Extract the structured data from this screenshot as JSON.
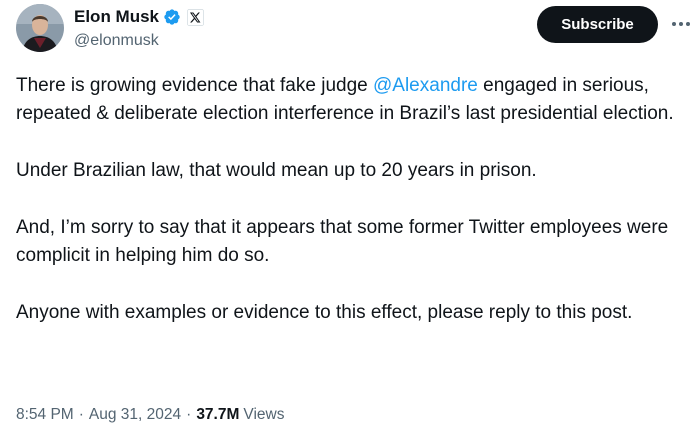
{
  "author": {
    "name": "Elon Musk",
    "handle": "@elonmusk",
    "verified": true,
    "affiliate_badge": "x-logo-icon"
  },
  "actions": {
    "subscribe_label": "Subscribe",
    "more_icon": "more-horizontal-icon"
  },
  "tweet": {
    "paragraphs": [
      {
        "before": "There is growing evidence that fake judge ",
        "mention": "@Alexandre",
        "after": " engaged in serious, repeated & deliberate election interference in Brazil’s last presidential election."
      },
      {
        "text": "Under Brazilian law, that would mean up to 20 years in prison."
      },
      {
        "text": "And, I’m sorry to say that it appears that some former Twitter employees were complicit in helping him do so."
      },
      {
        "text": "Anyone with examples or evidence to this effect, please reply to this post."
      }
    ]
  },
  "meta": {
    "time": "8:54 PM",
    "separator": "·",
    "date": "Aug 31, 2024",
    "views_count": "37.7M",
    "views_label": "Views"
  },
  "colors": {
    "text": "#0f1419",
    "secondary": "#536471",
    "accent": "#1d9bf0",
    "button_bg": "#0f1419"
  }
}
